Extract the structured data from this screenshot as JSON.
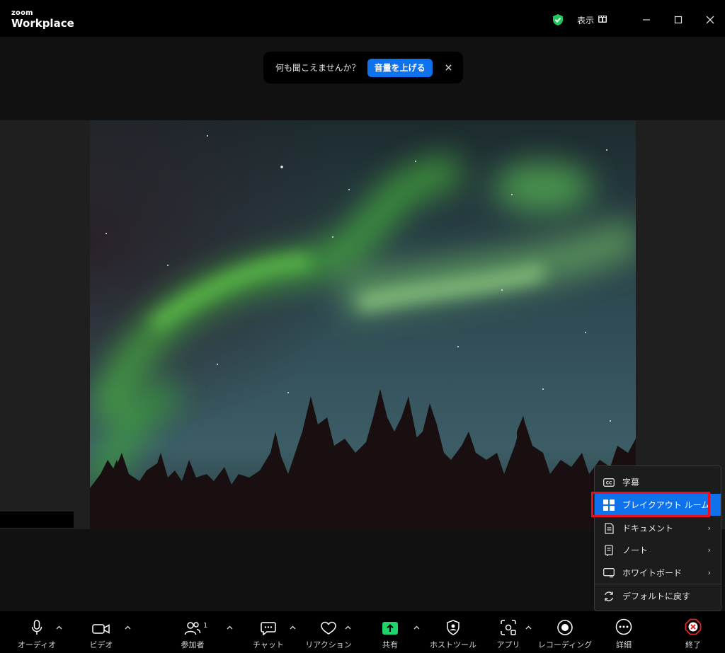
{
  "app": {
    "logo_small": "zoom",
    "logo_big": "Workplace",
    "view_label": "表示"
  },
  "toast": {
    "text": "何も聞こえませんか？",
    "button_label": "音量を上げる"
  },
  "menu": {
    "items": [
      {
        "label": "字幕",
        "icon": "cc-icon",
        "submenu": false
      },
      {
        "label": "ブレイクアウト ルーム",
        "icon": "breakout-rooms-icon",
        "submenu": false
      },
      {
        "label": "ドキュメント",
        "icon": "document-icon",
        "submenu": true
      },
      {
        "label": "ノート",
        "icon": "notes-icon",
        "submenu": true
      },
      {
        "label": "ホワイトボード",
        "icon": "whiteboard-icon",
        "submenu": true
      },
      {
        "label": "デフォルトに戻す",
        "icon": "reset-icon",
        "submenu": false
      }
    ],
    "arrow": "›"
  },
  "toolbar": {
    "audio": "オーディオ",
    "video": "ビデオ",
    "participants": "参加者",
    "participants_count": "1",
    "chat": "チャット",
    "reactions": "リアクション",
    "share": "共有",
    "host_tools": "ホストツール",
    "apps": "アプリ",
    "recording": "レコーディング",
    "more": "詳細",
    "end": "終了"
  },
  "colors": {
    "accent": "#0e72ed",
    "share_green": "#1fd46a",
    "end_red": "#e02828",
    "highlight_red": "#e8101f"
  }
}
